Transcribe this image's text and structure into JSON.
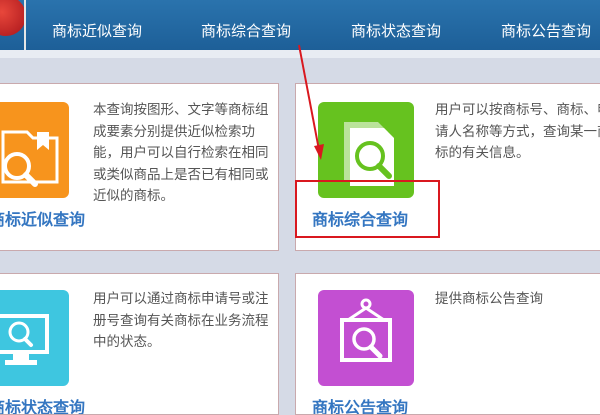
{
  "nav": {
    "items": [
      "商标近似查询",
      "商标综合查询",
      "商标状态查询",
      "商标公告查询"
    ]
  },
  "cards": [
    {
      "title": "商标近似查询",
      "desc": "本查询按图形、文字等商标组成要素分别提供近似检索功能，用户可以自行检索在相同或类似商品上是否已有相同或近似的商标。"
    },
    {
      "title": "商标综合查询",
      "desc": "用户可以按商标号、商标、申请人名称等方式，查询某一商标的有关信息。"
    },
    {
      "title": "商标状态查询",
      "desc": "用户可以通过商标申请号或注册号查询有关商标在业务流程中的状态。"
    },
    {
      "title": "商标公告查询",
      "desc": "提供商标公告查询"
    }
  ],
  "colors": {
    "nav_bg": "#2a73ad",
    "title": "#3476c1",
    "icon_orange": "#f7941d",
    "icon_green": "#66c21f",
    "icon_cyan": "#3ec6e0",
    "icon_purple": "#c34fd2",
    "annotation": "#d9181f"
  }
}
